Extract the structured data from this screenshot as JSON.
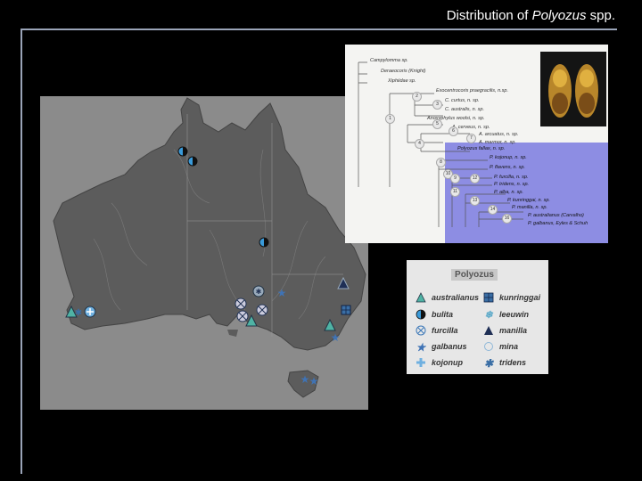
{
  "slide": {
    "title_prefix": "Distribution of ",
    "title_genus": "Polyozus",
    "title_suffix": " spp."
  },
  "legend": {
    "title": "Polyozus",
    "items": [
      {
        "label": "australianus",
        "icon": "triangle-icon",
        "color": "#4fb3a4"
      },
      {
        "label": "kunringgai",
        "icon": "grid-square-icon",
        "color": "#3a6ea5"
      },
      {
        "label": "bulita",
        "icon": "half-circle-icon",
        "color": "#3a9ad9"
      },
      {
        "label": "leeuwin",
        "icon": "snowflake-icon",
        "color": "#5aa8c8"
      },
      {
        "label": "furcilla",
        "icon": "crossed-circle-icon",
        "color": "#3c78b8"
      },
      {
        "label": "manilla",
        "icon": "dark-triangle-icon",
        "color": "#1f2f55"
      },
      {
        "label": "galbanus",
        "icon": "star-icon",
        "color": "#3f73b5"
      },
      {
        "label": "mina",
        "icon": "open-circle-icon",
        "color": "#8fb8d8"
      },
      {
        "label": "kojonup",
        "icon": "cross-icon",
        "color": "#6fb0e0"
      },
      {
        "label": "tridens",
        "icon": "asterisk-icon",
        "color": "#3a6ea5"
      }
    ]
  },
  "tree": {
    "taxa": [
      "Campylomma sp.",
      "Deraeocoris (Knight)",
      "Xiphiidae sp.",
      "Exocentrocoris praegracilis, n.sp.",
      "C. curtus, n. sp.",
      "C. australis, n. sp.",
      "Anoxyphylus woolsi, n. sp.",
      "A. cerveus, n. sp.",
      "A. arcuatus, n. sp.",
      "A. marmor, n. sp.",
      "Polyozus fallax, n. sp.",
      "P. kojonup, n. sp.",
      "P. flavens, n. sp.",
      "P. furcilla, n. sp.",
      "P. tridens, n. sp.",
      "P. alba, n. sp.",
      "P. kunringgai, n. sp.",
      "P. manilla, n. sp.",
      "P. australianus (Carvalho)",
      "P. galbanus, Eyles & Schuh"
    ],
    "nodes": [
      "1",
      "2",
      "3",
      "4",
      "5",
      "6",
      "7",
      "8",
      "9",
      "10",
      "11",
      "12",
      "13",
      "14",
      "15",
      "16"
    ]
  }
}
